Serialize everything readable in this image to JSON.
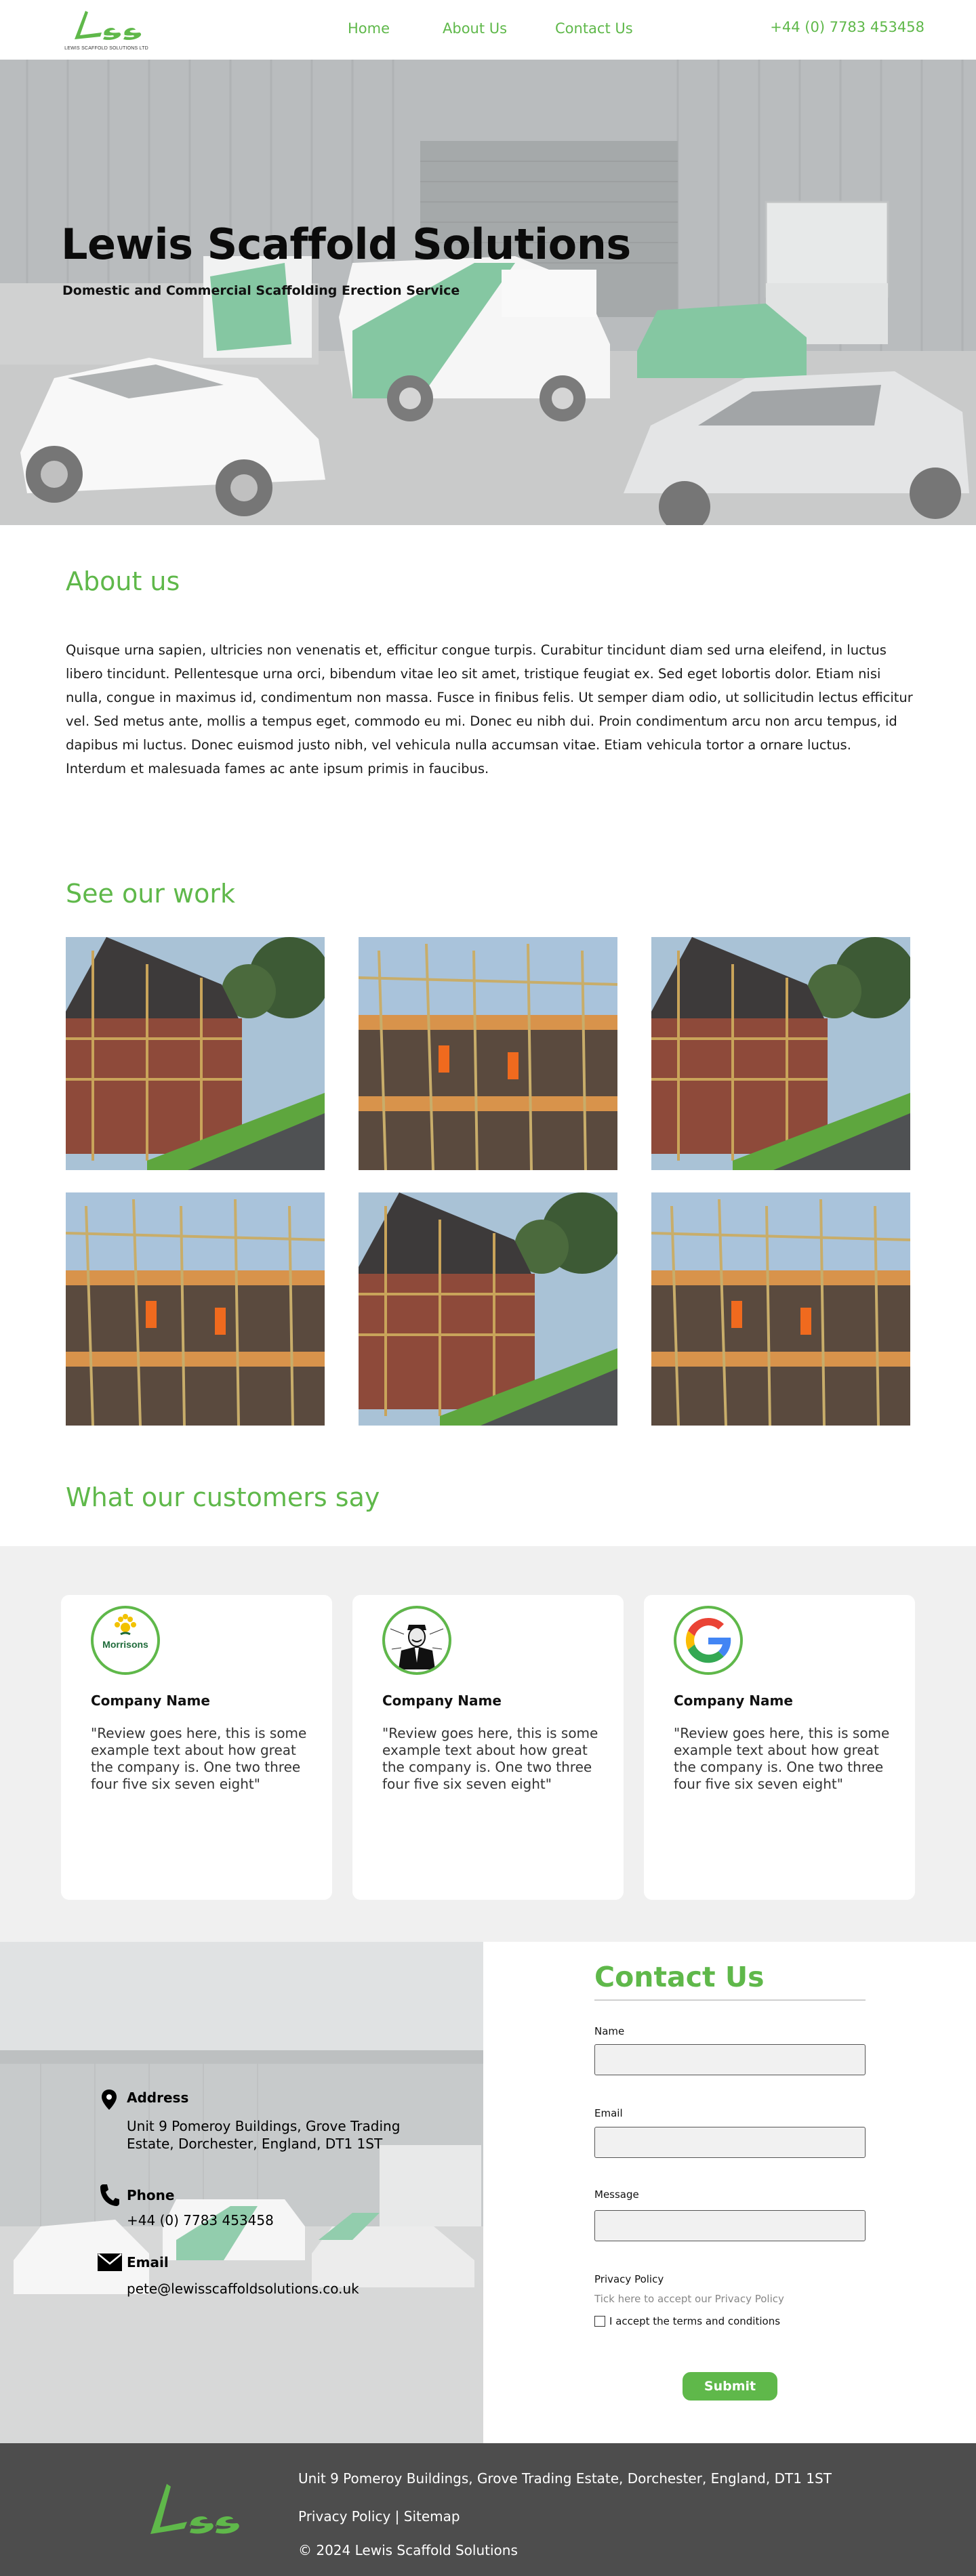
{
  "header": {
    "logo_text": "LEWIS SCAFFOLD SOLUTIONS LTD",
    "nav": [
      {
        "label": "Home"
      },
      {
        "label": "About Us"
      },
      {
        "label": "Contact Us"
      }
    ],
    "phone": "+44 (0) 7783 453458"
  },
  "hero": {
    "title": "Lewis Scaffold Solutions",
    "subtitle": "Domestic and Commercial Scaffolding Erection Service"
  },
  "about": {
    "title": "About us",
    "body": "Quisque urna sapien, ultricies non venenatis et, efficitur congue turpis. Curabitur tincidunt diam sed urna eleifend, in luctus libero tincidunt. Pellentesque urna orci, bibendum vitae leo sit amet, tristique feugiat ex. Sed eget lobortis dolor. Etiam nisi nulla, congue in maximus id, condimentum non massa. Fusce in finibus felis. Ut semper diam odio, ut sollicitudin lectus efficitur vel. Sed metus ante, mollis a tempus eget, commodo eu mi. Donec eu nibh dui. Proin condimentum arcu non arcu tempus, id dapibus mi luctus. Donec euismod justo nibh, vel vehicula nulla accumsan vitae. Etiam vehicula tortor a ornare luctus. Interdum et malesuada fames ac ante ipsum primis in faucibus."
  },
  "work": {
    "title": "See our work",
    "images": [
      "house-scaffold",
      "workers-scaffold",
      "house-scaffold",
      "workers-scaffold",
      "house-scaffold",
      "workers-scaffold"
    ]
  },
  "testimonials": {
    "title": "What our customers say",
    "cards": [
      {
        "logo": "morrisons-logo",
        "logo_text": "Morrisons",
        "company": "Company Name",
        "review": "\"Review goes here, this is some example text about how great the company is.  One two three four five six seven eight\""
      },
      {
        "logo": "anonymous-logo",
        "company": "Company Name",
        "review": "\"Review goes here, this is some example text about how great the company is.  One two three four five six seven eight\""
      },
      {
        "logo": "google-logo",
        "company": "Company Name",
        "review": "\"Review goes here, this is some example text about how great the company is.  One two three four five six seven eight\""
      }
    ]
  },
  "contact_info": {
    "address_label": "Address",
    "address": "Unit 9 Pomeroy Buildings, Grove Trading Estate, Dorchester, England, DT1 1ST",
    "phone_label": "Phone",
    "phone": "+44 (0) 7783 453458",
    "email_label": "Email",
    "email": "pete@lewisscaffoldsolutions.co.uk"
  },
  "contact_form": {
    "title": "Contact Us",
    "name_label": "Name",
    "email_label": "Email",
    "message_label": "Message",
    "privacy_label": "Privacy Policy",
    "privacy_link": "Tick here to accept our Privacy Policy",
    "terms_label": "I accept the terms and conditions",
    "submit_label": "Submit"
  },
  "footer": {
    "address": "Unit 9 Pomeroy Buildings, Grove Trading Estate, Dorchester, England, DT1 1ST",
    "privacy": "Privacy Policy",
    "separator": "|",
    "sitemap": "Sitemap",
    "copyright": "© 2024 Lewis Scaffold Solutions"
  },
  "colors": {
    "brand_green": "#5fb84a",
    "footer_bg": "#4d4d4d",
    "band_bg": "#f0f0f0"
  }
}
